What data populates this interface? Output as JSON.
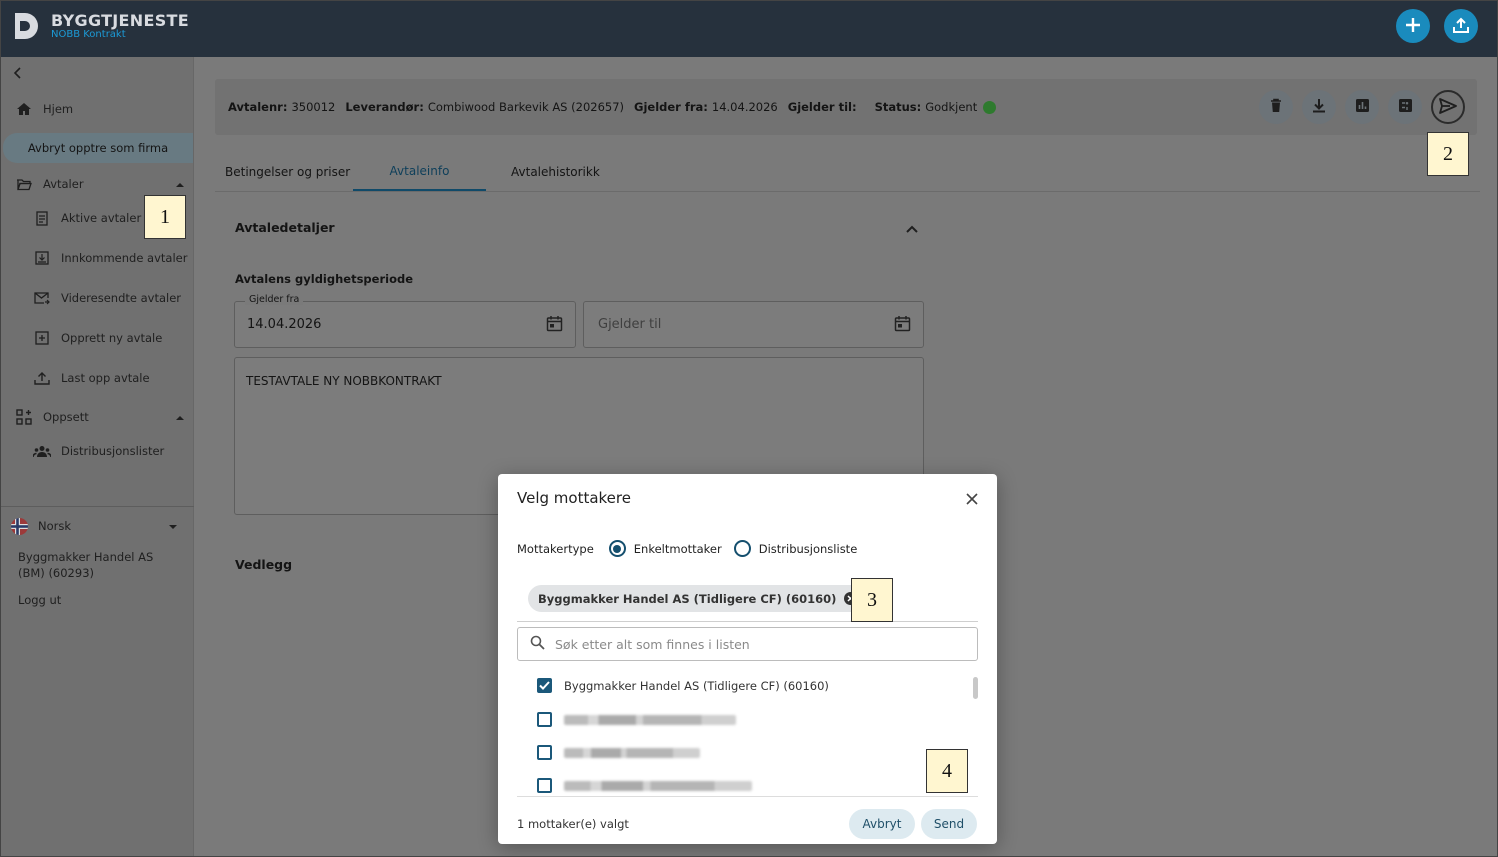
{
  "app": {
    "brand_title": "BYGGTJENESTE",
    "brand_subtitle": "NOBB Kontrakt",
    "top_icons": [
      "plus-icon",
      "upload-icon"
    ]
  },
  "sidebar": {
    "home": "Hjem",
    "stop_impersonate": "Avbryt opptre som firma",
    "agreements_group": "Avtaler",
    "agreements_items": [
      "Aktive avtaler",
      "Innkommende avtaler",
      "Videresendte avtaler",
      "Opprett ny avtale",
      "Last opp avtale"
    ],
    "setup_group": "Oppsett",
    "setup_items": [
      "Distribusjonslister"
    ],
    "language": "Norsk",
    "company": "Byggmakker Handel AS (BM) (60293)",
    "logout": "Logg ut"
  },
  "infobar": {
    "agreement_no_label": "Avtalenr:",
    "agreement_no": "350012",
    "supplier_label": "Leverandør:",
    "supplier": "Combiwood Barkevik AS (202657)",
    "valid_from_label": "Gjelder fra:",
    "valid_from": "14.04.2026",
    "valid_to_label": "Gjelder til:",
    "valid_to": "",
    "status_label": "Status:",
    "status": "Godkjent",
    "status_color": "#2e7a2e",
    "actions": [
      "trash-icon",
      "download-icon",
      "chart-icon",
      "dashboard-icon",
      "send-icon"
    ]
  },
  "tabs": [
    "Betingelser og priser",
    "Avtaleinfo",
    "Avtalehistorikk"
  ],
  "active_tab": "Avtaleinfo",
  "details": {
    "section_title": "Avtaledetaljer",
    "period_title": "Avtalens gyldighetsperiode",
    "valid_from_field_label": "Gjelder fra",
    "valid_from_value": "14.04.2026",
    "valid_to_placeholder": "Gjelder til",
    "description": "TESTAVTALE NY NOBBKONTRAKT",
    "attachments_title": "Vedlegg"
  },
  "callouts": [
    "1",
    "2",
    "3",
    "4"
  ],
  "modal": {
    "title": "Velg mottakere",
    "recipient_type_label": "Mottakertype",
    "option_single": "Enkeltmottaker",
    "option_list": "Distribusjonsliste",
    "selected_option": "Enkeltmottaker",
    "chip": "Byggmakker Handel AS (Tidligere CF) (60160)",
    "search_placeholder": "Søk etter alt som finnes i listen",
    "items": [
      {
        "label": "Byggmakker Handel AS (Tidligere CF) (60160)",
        "checked": true
      }
    ],
    "selected_count": "1 mottaker(e) valgt",
    "cancel": "Avbryt",
    "send": "Send"
  }
}
